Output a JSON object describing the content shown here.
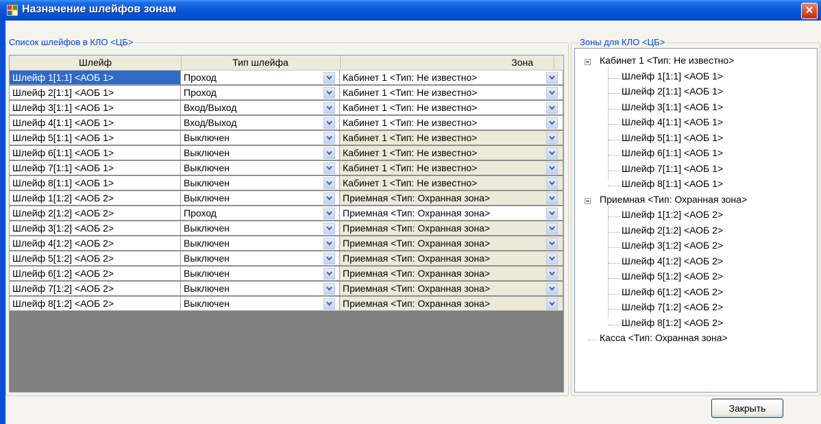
{
  "window": {
    "title": "Назначение шлейфов зонам",
    "close_label": "✕"
  },
  "loops_group": {
    "legend": "Список шлейфов в КЛО <ЦБ>",
    "columns": [
      "Шлейф",
      "Тип шлейфа",
      "Зона"
    ],
    "selected_row": 0,
    "rows": [
      {
        "loop": "Шлейф 1[1:1]  <АОБ 1>",
        "type": "Проход",
        "zone": "Кабинет 1  <Тип: Не известно>"
      },
      {
        "loop": "Шлейф 2[1:1]  <АОБ 1>",
        "type": "Проход",
        "zone": "Кабинет 1  <Тип: Не известно>"
      },
      {
        "loop": "Шлейф 3[1:1]  <АОБ 1>",
        "type": "Вход/Выход",
        "zone": "Кабинет 1  <Тип: Не известно>"
      },
      {
        "loop": "Шлейф 4[1:1]  <АОБ 1>",
        "type": "Вход/Выход",
        "zone": "Кабинет 1  <Тип: Не известно>"
      },
      {
        "loop": "Шлейф 5[1:1]  <АОБ 1>",
        "type": "Выключен",
        "zone": "Кабинет 1  <Тип: Не известно>"
      },
      {
        "loop": "Шлейф 6[1:1]  <АОБ 1>",
        "type": "Выключен",
        "zone": "Кабинет 1  <Тип: Не известно>"
      },
      {
        "loop": "Шлейф 7[1:1]  <АОБ 1>",
        "type": "Выключен",
        "zone": "Кабинет 1  <Тип: Не известно>"
      },
      {
        "loop": "Шлейф 8[1:1]  <АОБ 1>",
        "type": "Выключен",
        "zone": "Кабинет 1  <Тип: Не известно>"
      },
      {
        "loop": "Шлейф 1[1:2]  <АОБ 2>",
        "type": "Выключен",
        "zone": "Приемная  <Тип: Охранная зона>"
      },
      {
        "loop": "Шлейф 2[1:2]  <АОБ 2>",
        "type": "Проход",
        "zone": "Приемная  <Тип: Охранная зона>"
      },
      {
        "loop": "Шлейф 3[1:2]  <АОБ 2>",
        "type": "Выключен",
        "zone": "Приемная  <Тип: Охранная зона>"
      },
      {
        "loop": "Шлейф 4[1:2]  <АОБ 2>",
        "type": "Выключен",
        "zone": "Приемная  <Тип: Охранная зона>"
      },
      {
        "loop": "Шлейф 5[1:2]  <АОБ 2>",
        "type": "Выключен",
        "zone": "Приемная  <Тип: Охранная зона>"
      },
      {
        "loop": "Шлейф 6[1:2]  <АОБ 2>",
        "type": "Выключен",
        "zone": "Приемная  <Тип: Охранная зона>"
      },
      {
        "loop": "Шлейф 7[1:2]  <АОБ 2>",
        "type": "Выключен",
        "zone": "Приемная  <Тип: Охранная зона>"
      },
      {
        "loop": "Шлейф 8[1:2]  <АОБ 2>",
        "type": "Выключен",
        "zone": "Приемная  <Тип: Охранная зона>"
      }
    ]
  },
  "zones_group": {
    "legend": "Зоны для КЛО <ЦБ>",
    "tree": [
      {
        "label": "Кабинет 1  <Тип: Не известно>",
        "expanded": true,
        "children": [
          "Шлейф 1[1:1]  <АОБ 1>",
          "Шлейф 2[1:1]  <АОБ 1>",
          "Шлейф 3[1:1]  <АОБ 1>",
          "Шлейф 4[1:1]  <АОБ 1>",
          "Шлейф 5[1:1]  <АОБ 1>",
          "Шлейф 6[1:1]  <АОБ 1>",
          "Шлейф 7[1:1]  <АОБ 1>",
          "Шлейф 8[1:1]  <АОБ 1>"
        ]
      },
      {
        "label": "Приемная  <Тип: Охранная зона>",
        "expanded": true,
        "children": [
          "Шлейф 1[1:2]  <АОБ 2>",
          "Шлейф 2[1:2]  <АОБ 2>",
          "Шлейф 3[1:2]  <АОБ 2>",
          "Шлейф 4[1:2]  <АОБ 2>",
          "Шлейф 5[1:2]  <АОБ 2>",
          "Шлейф 6[1:2]  <АОБ 2>",
          "Шлейф 7[1:2]  <АОБ 2>",
          "Шлейф 8[1:2]  <АОБ 2>"
        ]
      },
      {
        "label": "Касса  <Тип: Охранная зона>",
        "expanded": false,
        "children": []
      }
    ]
  },
  "buttons": {
    "close": "Закрыть"
  },
  "icons": {
    "app": "app-icon",
    "dropdown": "chevron-down-icon",
    "expander": "collapse-icon"
  },
  "colors": {
    "selection": "#316ac5",
    "titlebar": "#0a58d8",
    "legend_text": "#0046d5"
  }
}
